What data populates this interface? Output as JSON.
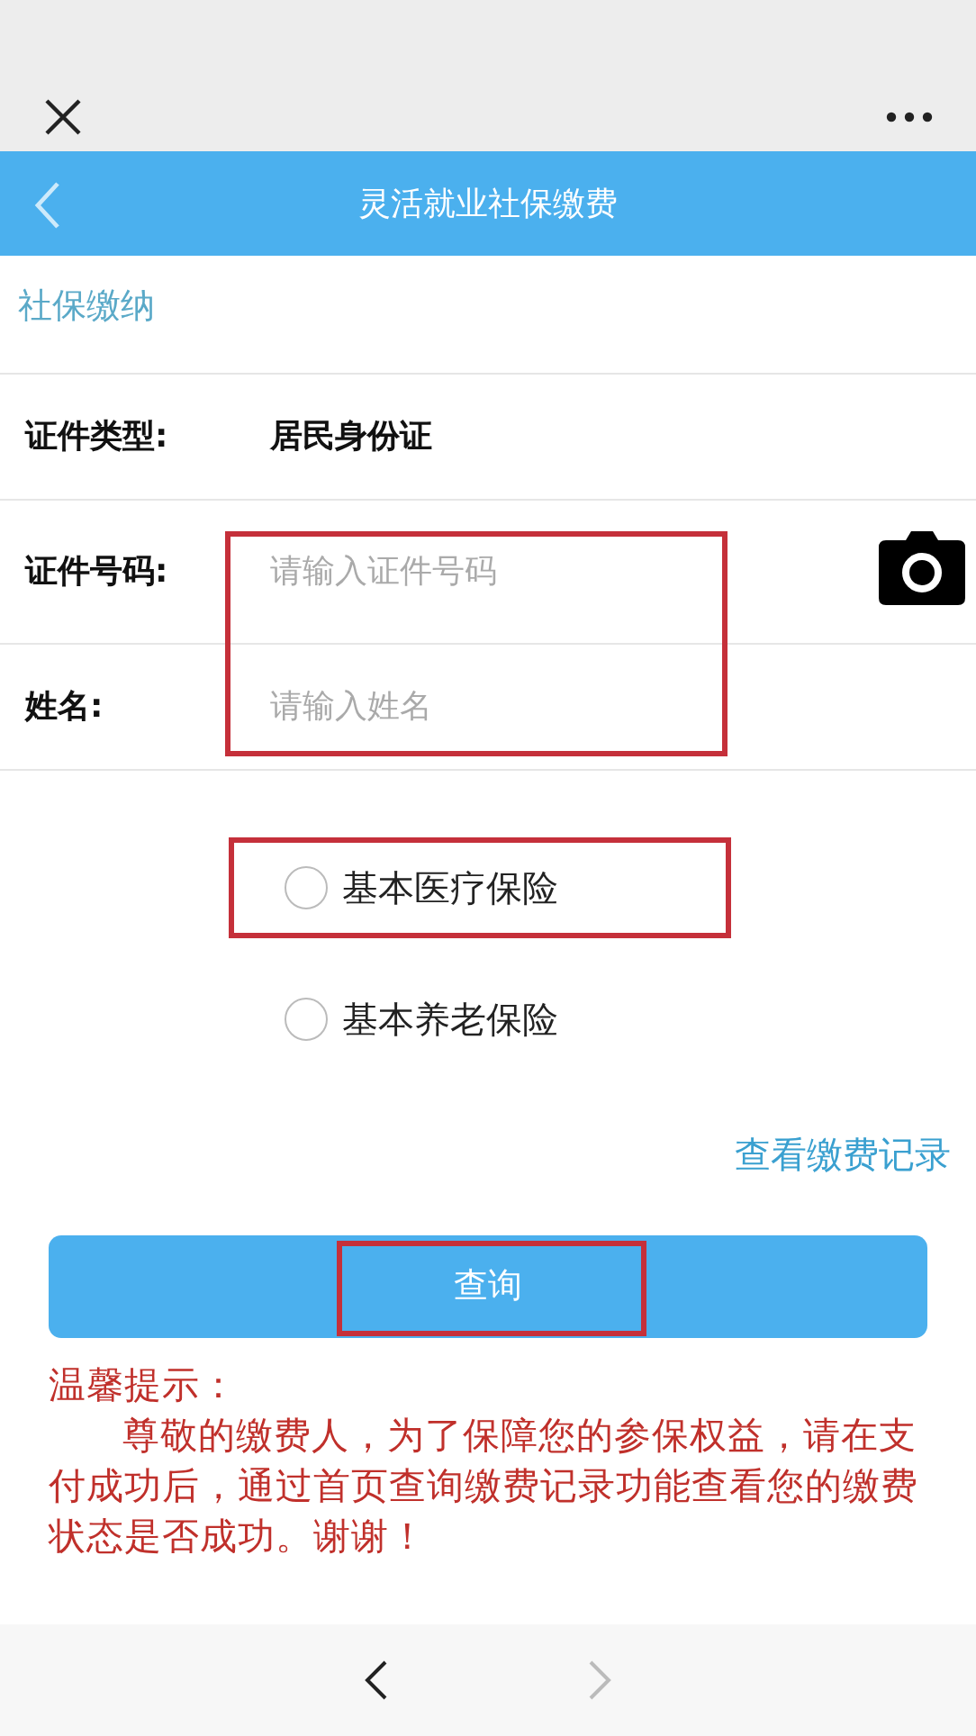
{
  "header": {
    "title": "灵活就业社保缴费"
  },
  "section_title": "社保缴纳",
  "id_type": {
    "label": "证件类型:",
    "value": "居民身份证"
  },
  "inputs": {
    "highlighted": true,
    "fields": [
      {
        "label": "证件号码:",
        "placeholder": "请输入证件号码",
        "camera": true
      },
      {
        "label": "姓名:",
        "placeholder": "请输入姓名",
        "camera": false
      }
    ]
  },
  "options": [
    {
      "label": "基本医疗保险",
      "selected": false,
      "highlighted": true
    },
    {
      "label": "基本养老保险",
      "selected": false,
      "highlighted": false
    }
  ],
  "records_link": "查看缴费记录",
  "query_button": {
    "label": "查询",
    "highlighted": true
  },
  "notice": {
    "title": "温馨提示：",
    "body": "尊敬的缴费人，为了保障您的参保权益，请在支付成功后，通过首页查询缴费记录功能查看您的缴费状态是否成功。谢谢！"
  },
  "bottom_nav": {
    "back_disabled": false,
    "forward_disabled": true
  }
}
